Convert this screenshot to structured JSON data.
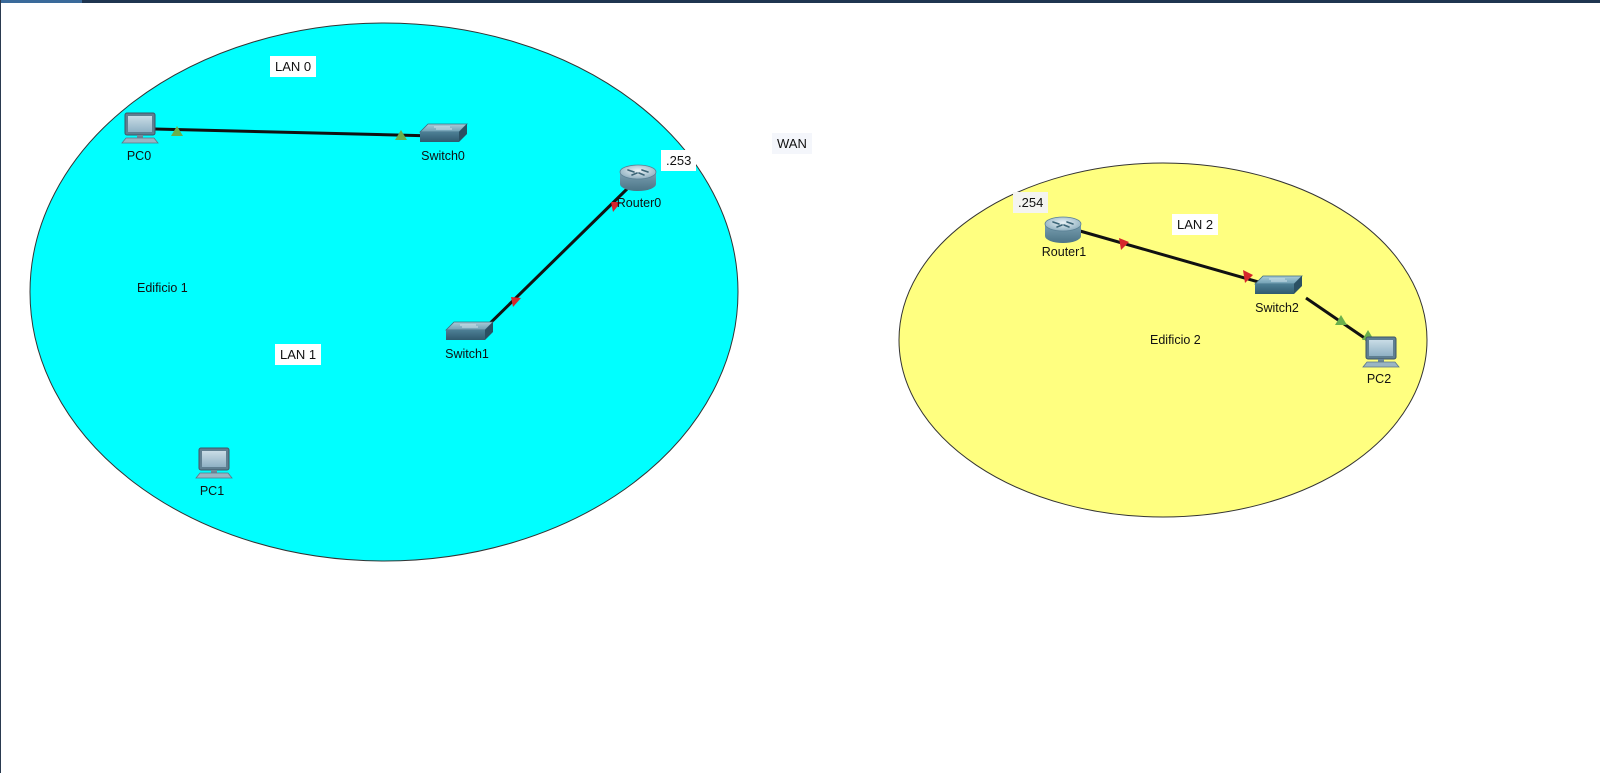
{
  "colors": {
    "zone_edificio1": "#00ffff",
    "zone_edificio2": "#ffff80",
    "link_up": "#6ab04c",
    "link_down": "#d6262c",
    "cable": "#111111"
  },
  "labels": {
    "lan0": "LAN 0",
    "lan1": "LAN 1",
    "lan2": "LAN 2",
    "wan": "WAN",
    "edificio1": "Edificio 1",
    "edificio2": "Edificio 2",
    "ip_router0": ".253",
    "ip_router1": ".254"
  },
  "devices": {
    "pc0": {
      "name": "PC0",
      "icon": "pc-icon"
    },
    "pc1": {
      "name": "PC1",
      "icon": "pc-icon"
    },
    "pc2": {
      "name": "PC2",
      "icon": "pc-icon"
    },
    "switch0": {
      "name": "Switch0",
      "icon": "switch-icon"
    },
    "switch1": {
      "name": "Switch1",
      "icon": "switch-icon"
    },
    "switch2": {
      "name": "Switch2",
      "icon": "switch-icon"
    },
    "router0": {
      "name": "Router0",
      "icon": "router-icon"
    },
    "router1": {
      "name": "Router1",
      "icon": "router-icon"
    }
  },
  "links": [
    {
      "from": "PC0",
      "to": "Switch0",
      "state_from": "up",
      "state_to": "up"
    },
    {
      "from": "Switch1",
      "to": "Router0",
      "state_from": "down",
      "state_to": "down"
    },
    {
      "from": "Router1",
      "to": "Switch2",
      "state_from": "down",
      "state_to": "down"
    },
    {
      "from": "Switch2",
      "to": "PC2",
      "state_from": "up",
      "state_to": "up"
    }
  ]
}
